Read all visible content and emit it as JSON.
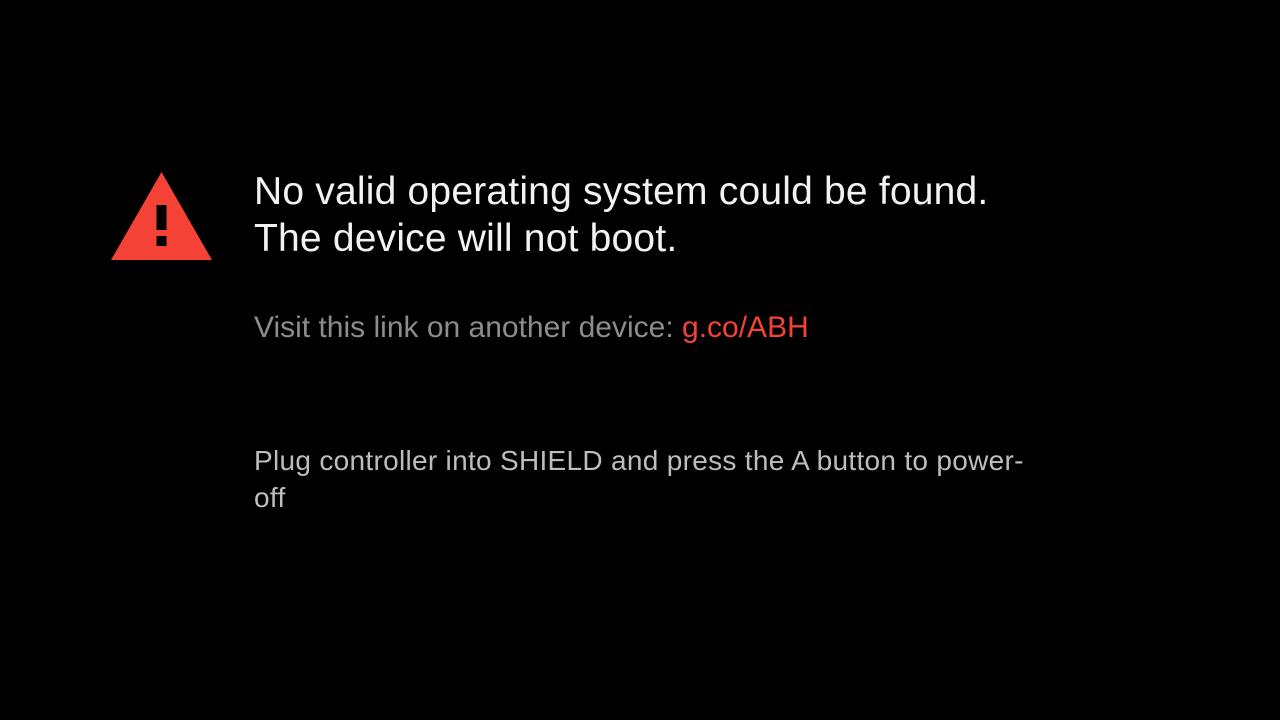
{
  "error_screen": {
    "icon": "warning-triangle-icon",
    "icon_color": "#f44336",
    "headline_line_1": "No valid operating system could be found.",
    "headline_line_2": "The device will not boot.",
    "link_prefix": "Visit this link on another device: ",
    "link_text": "g.co/ABH",
    "link_color": "#f44336",
    "instruction": "Plug controller into SHIELD and press the A button to power-off"
  },
  "colors": {
    "background": "#000000",
    "headline": "#f2f2f2",
    "secondary_text": "#8c8c8c",
    "instruction_text": "#bdbdbd"
  }
}
